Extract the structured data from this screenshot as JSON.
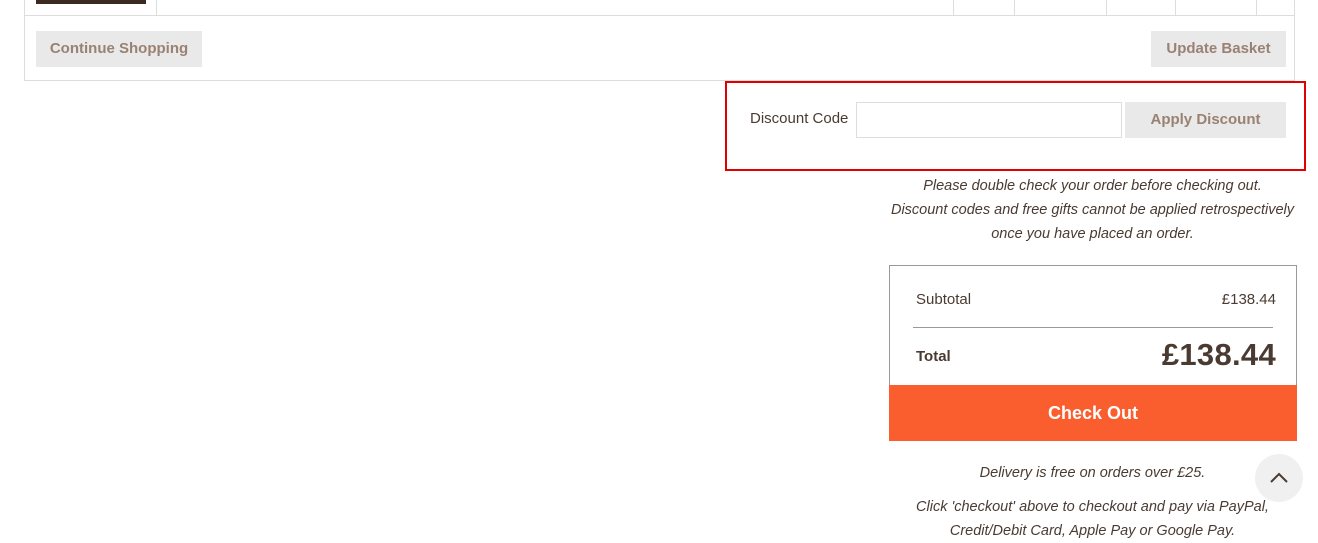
{
  "basket": {
    "continue_label": "Continue Shopping",
    "update_label": "Update Basket"
  },
  "discount": {
    "label": "Discount Code",
    "input_value": "",
    "input_placeholder": "",
    "apply_label": "Apply Discount"
  },
  "notice": {
    "line1": "Please double check your order before checking out.",
    "line2": "Discount codes and free gifts cannot be applied retrospectively",
    "line3": "once you have placed an order."
  },
  "totals": {
    "subtotal_label": "Subtotal",
    "subtotal_value": "£138.44",
    "total_label": "Total",
    "total_value": "£138.44",
    "checkout_label": "Check Out"
  },
  "footer_notes": {
    "delivery": "Delivery is free on orders over £25.",
    "payment_line1": "Click 'checkout' above to checkout and pay via PayPal,",
    "payment_line2": "Credit/Debit Card, Apple Pay or Google Pay."
  },
  "icons": {
    "scroll_top": "chevron-up-icon"
  },
  "colors": {
    "checkout": "#fb5e2e",
    "highlight_border": "#e00000",
    "text": "#4a3b32",
    "button_text": "#9a8272"
  }
}
